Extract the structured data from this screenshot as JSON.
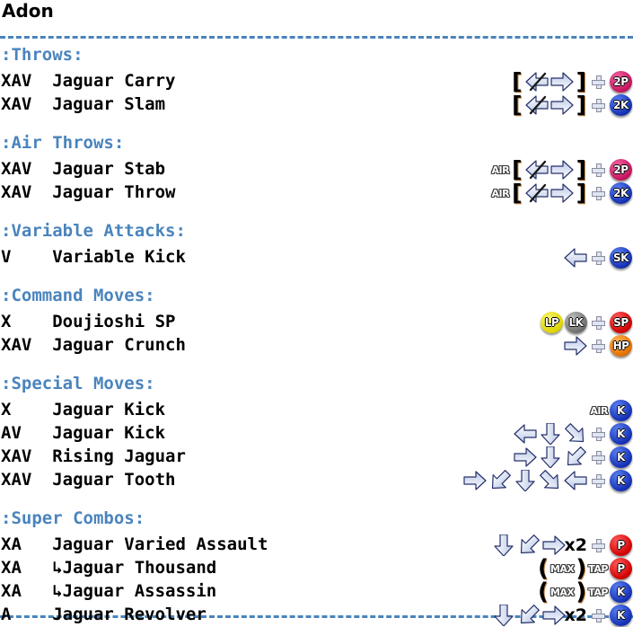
{
  "character": {
    "name": "Adon"
  },
  "divider": {
    "style": "dashed",
    "color": "#4a84bd"
  },
  "colors": {
    "section_heading": "#4a84bd",
    "body_text": "#000000",
    "badge_2p": "#c4145c",
    "badge_2k": "#1430b4",
    "badge_sk": "#1430b4",
    "badge_k": "#1430b4",
    "badge_p": "#d00000",
    "badge_sp": "#d00000",
    "badge_hp": "#e07000",
    "badge_lp": "#ddd400",
    "badge_lk": "#6e6e6e"
  },
  "sections": [
    {
      "heading": ":Throws:",
      "moves": [
        {
          "groove": "XAV",
          "name": "Jaguar Carry",
          "inputs": [
            {
              "type": "bracket",
              "glyph": "["
            },
            {
              "type": "arrow",
              "dir": "left-slash"
            },
            {
              "type": "arrow",
              "dir": "right"
            },
            {
              "type": "bracket",
              "glyph": "]"
            },
            {
              "type": "plus"
            },
            {
              "type": "badge",
              "label": "2P",
              "color": "b-2p"
            }
          ]
        },
        {
          "groove": "XAV",
          "name": "Jaguar Slam",
          "inputs": [
            {
              "type": "bracket",
              "glyph": "["
            },
            {
              "type": "arrow",
              "dir": "left-slash"
            },
            {
              "type": "arrow",
              "dir": "right"
            },
            {
              "type": "bracket",
              "glyph": "]"
            },
            {
              "type": "plus"
            },
            {
              "type": "badge",
              "label": "2K",
              "color": "b-2k"
            }
          ]
        }
      ]
    },
    {
      "heading": ":Air Throws:",
      "moves": [
        {
          "groove": "XAV",
          "name": "Jaguar Stab",
          "inputs": [
            {
              "type": "tag",
              "label": "AIR"
            },
            {
              "type": "bracket",
              "glyph": "["
            },
            {
              "type": "arrow",
              "dir": "left-slash"
            },
            {
              "type": "arrow",
              "dir": "right"
            },
            {
              "type": "bracket",
              "glyph": "]"
            },
            {
              "type": "plus"
            },
            {
              "type": "badge",
              "label": "2P",
              "color": "b-2p"
            }
          ]
        },
        {
          "groove": "XAV",
          "name": "Jaguar Throw",
          "inputs": [
            {
              "type": "tag",
              "label": "AIR"
            },
            {
              "type": "bracket",
              "glyph": "["
            },
            {
              "type": "arrow",
              "dir": "left-slash"
            },
            {
              "type": "arrow",
              "dir": "right"
            },
            {
              "type": "bracket",
              "glyph": "]"
            },
            {
              "type": "plus"
            },
            {
              "type": "badge",
              "label": "2K",
              "color": "b-2k"
            }
          ]
        }
      ]
    },
    {
      "heading": ":Variable Attacks:",
      "moves": [
        {
          "groove": "V",
          "name": "Variable Kick",
          "inputs": [
            {
              "type": "arrow",
              "dir": "left"
            },
            {
              "type": "plus"
            },
            {
              "type": "badge",
              "label": "SK",
              "color": "b-sk"
            }
          ]
        }
      ]
    },
    {
      "heading": ":Command Moves:",
      "moves": [
        {
          "groove": "X",
          "name": "Doujioshi SP",
          "inputs": [
            {
              "type": "badge",
              "label": "LP",
              "color": "b-lp"
            },
            {
              "type": "badge",
              "label": "LK",
              "color": "b-lk"
            },
            {
              "type": "plus"
            },
            {
              "type": "badge",
              "label": "SP",
              "color": "b-sp"
            }
          ]
        },
        {
          "groove": "XAV",
          "name": "Jaguar Crunch",
          "inputs": [
            {
              "type": "arrow",
              "dir": "right"
            },
            {
              "type": "plus"
            },
            {
              "type": "badge",
              "label": "HP",
              "color": "b-hp"
            }
          ]
        }
      ]
    },
    {
      "heading": ":Special Moves:",
      "moves": [
        {
          "groove": "X",
          "name": "Jaguar Kick",
          "inputs": [
            {
              "type": "tag",
              "label": "AIR"
            },
            {
              "type": "badge",
              "label": "K",
              "color": "b-k"
            }
          ]
        },
        {
          "groove": "AV",
          "name": "Jaguar Kick",
          "inputs": [
            {
              "type": "arrow",
              "dir": "left"
            },
            {
              "type": "arrow",
              "dir": "down"
            },
            {
              "type": "arrow",
              "dir": "down-right"
            },
            {
              "type": "plus"
            },
            {
              "type": "badge",
              "label": "K",
              "color": "b-k"
            }
          ]
        },
        {
          "groove": "XAV",
          "name": "Rising Jaguar",
          "inputs": [
            {
              "type": "arrow",
              "dir": "right"
            },
            {
              "type": "arrow",
              "dir": "down"
            },
            {
              "type": "arrow",
              "dir": "down-left"
            },
            {
              "type": "plus"
            },
            {
              "type": "badge",
              "label": "K",
              "color": "b-k"
            }
          ]
        },
        {
          "groove": "XAV",
          "name": "Jaguar Tooth",
          "inputs": [
            {
              "type": "arrow",
              "dir": "right"
            },
            {
              "type": "arrow",
              "dir": "down-left"
            },
            {
              "type": "arrow",
              "dir": "down"
            },
            {
              "type": "arrow",
              "dir": "down-right"
            },
            {
              "type": "arrow",
              "dir": "left"
            },
            {
              "type": "plus"
            },
            {
              "type": "badge",
              "label": "K",
              "color": "b-k"
            }
          ]
        }
      ]
    },
    {
      "heading": ":Super Combos:",
      "moves": [
        {
          "groove": "XA",
          "name": "Jaguar Varied Assault",
          "inputs": [
            {
              "type": "arrow",
              "dir": "down"
            },
            {
              "type": "arrow",
              "dir": "down-left"
            },
            {
              "type": "arrow",
              "dir": "right"
            },
            {
              "type": "x2",
              "label": "x2"
            },
            {
              "type": "plus"
            },
            {
              "type": "badge",
              "label": "P",
              "color": "b-p"
            }
          ]
        },
        {
          "groove": "XA",
          "name": "Jaguar Thousand",
          "sub": true,
          "inputs": [
            {
              "type": "paren",
              "glyph": "("
            },
            {
              "type": "tag",
              "label": "MAX"
            },
            {
              "type": "paren",
              "glyph": ")"
            },
            {
              "type": "tag",
              "label": "TAP"
            },
            {
              "type": "badge",
              "label": "P",
              "color": "b-p"
            }
          ]
        },
        {
          "groove": "XA",
          "name": "Jaguar Assassin",
          "sub": true,
          "inputs": [
            {
              "type": "paren",
              "glyph": "("
            },
            {
              "type": "tag",
              "label": "MAX"
            },
            {
              "type": "paren",
              "glyph": ")"
            },
            {
              "type": "tag",
              "label": "TAP"
            },
            {
              "type": "badge",
              "label": "K",
              "color": "b-k"
            }
          ]
        },
        {
          "groove": "A",
          "name": "Jaguar Revolver",
          "inputs": [
            {
              "type": "arrow",
              "dir": "down"
            },
            {
              "type": "arrow",
              "dir": "down-left"
            },
            {
              "type": "arrow",
              "dir": "right"
            },
            {
              "type": "x2",
              "label": "x2"
            },
            {
              "type": "plus"
            },
            {
              "type": "badge",
              "label": "K",
              "color": "b-k"
            }
          ]
        }
      ]
    }
  ]
}
